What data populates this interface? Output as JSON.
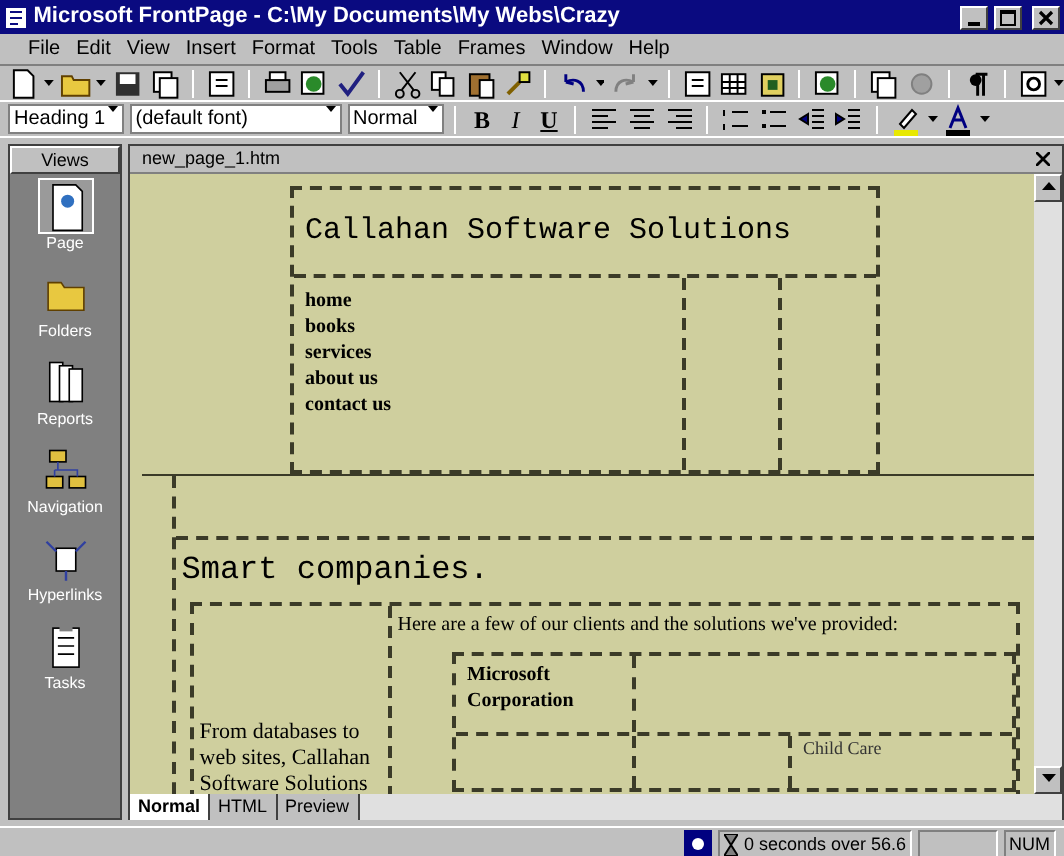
{
  "window": {
    "title": "Microsoft FrontPage - C:\\My Documents\\My Webs\\Crazy"
  },
  "menu": [
    "File",
    "Edit",
    "View",
    "Insert",
    "Format",
    "Tools",
    "Table",
    "Frames",
    "Window",
    "Help"
  ],
  "format_bar": {
    "style": "Heading 1",
    "font": "(default font)",
    "size": "Normal",
    "buttons": [
      "B",
      "I",
      "U"
    ]
  },
  "views": {
    "title": "Views",
    "items": [
      {
        "label": "Page",
        "selected": true
      },
      {
        "label": "Folders",
        "selected": false
      },
      {
        "label": "Reports",
        "selected": false
      },
      {
        "label": "Navigation",
        "selected": false
      },
      {
        "label": "Hyperlinks",
        "selected": false
      },
      {
        "label": "Tasks",
        "selected": false
      }
    ]
  },
  "document": {
    "tab": "new_page_1.htm",
    "site_title": "Callahan Software Solutions",
    "links": [
      "home",
      "books",
      "services",
      "about us",
      "contact us"
    ],
    "headline": "Smart companies.",
    "intro": "From databases to web sites, Callahan Software Solutions",
    "clients_intro": "Here are a few of our clients and the solutions we've provided:",
    "client": "Microsoft Corporation",
    "client_cell": "Child Care"
  },
  "view_tabs": [
    {
      "label": "Normal",
      "selected": true
    },
    {
      "label": "HTML",
      "selected": false
    },
    {
      "label": "Preview",
      "selected": false
    }
  ],
  "status_bar": {
    "download": "0 seconds over 56.6",
    "num": "NUM"
  }
}
